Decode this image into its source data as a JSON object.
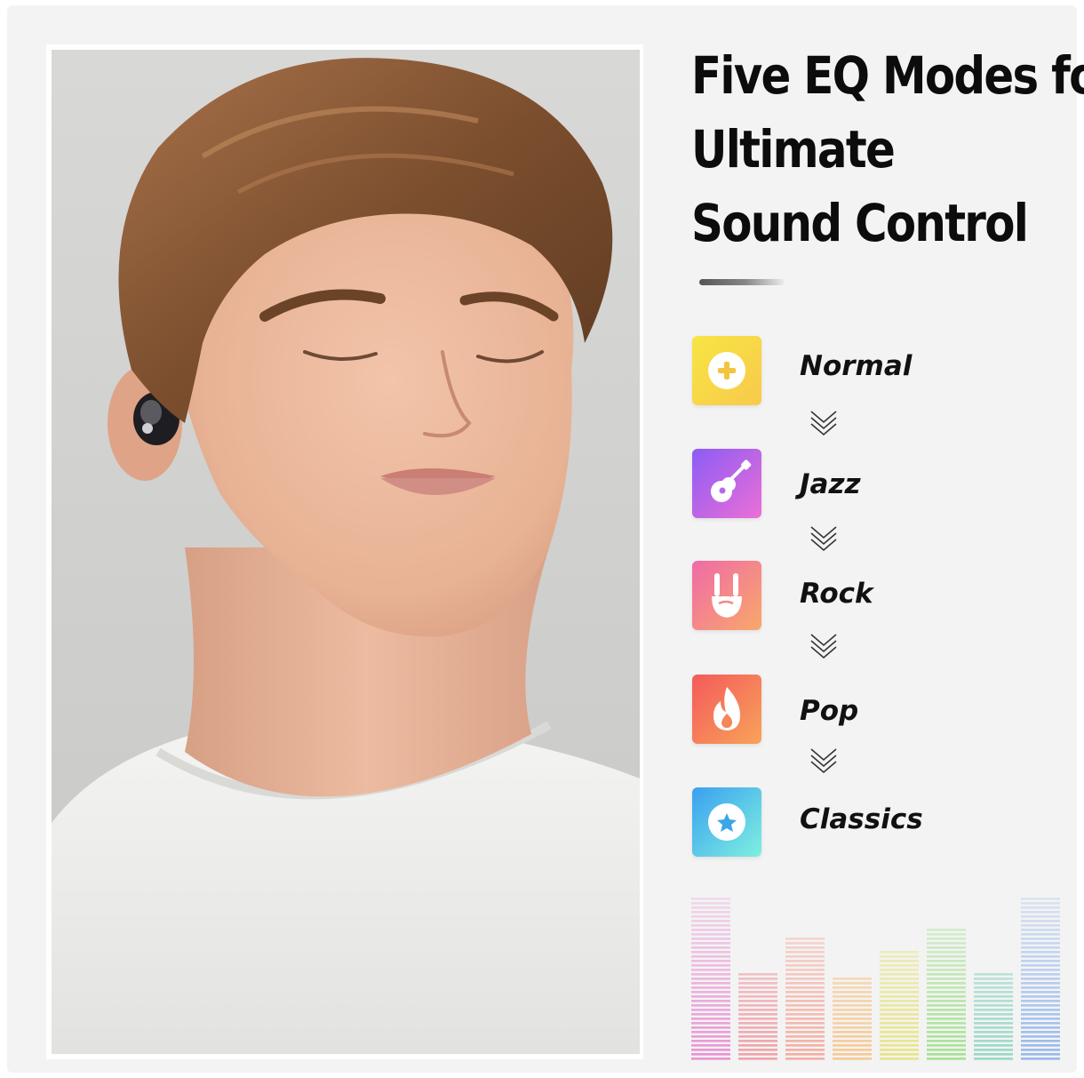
{
  "headline": {
    "line1": "Five EQ Modes for",
    "line2": "Ultimate",
    "line3": "Sound Control"
  },
  "modes": [
    {
      "label": "Normal",
      "icon": "plus-circle-icon",
      "colors": [
        "#f7e545",
        "#f9c94a"
      ]
    },
    {
      "label": "Jazz",
      "icon": "guitar-icon",
      "colors": [
        "#8b5cf6",
        "#ec6fd6"
      ]
    },
    {
      "label": "Rock",
      "icon": "rock-hand-icon",
      "colors": [
        "#f06aa8",
        "#f8a86a"
      ]
    },
    {
      "label": "Pop",
      "icon": "flame-icon",
      "colors": [
        "#f45a5a",
        "#f8a35a"
      ]
    },
    {
      "label": "Classics",
      "icon": "star-circle-icon",
      "colors": [
        "#3aa0f0",
        "#7ef0e0"
      ]
    }
  ],
  "equalizer": {
    "levels": [
      1.0,
      0.55,
      0.77,
      0.52,
      0.68,
      0.81,
      0.55,
      1.0
    ],
    "colors": [
      "#e98ad0",
      "#f09aa2",
      "#f5a79a",
      "#f7c58a",
      "#e6e37a",
      "#9ee08a",
      "#90d6c2",
      "#8fb3ec"
    ]
  }
}
